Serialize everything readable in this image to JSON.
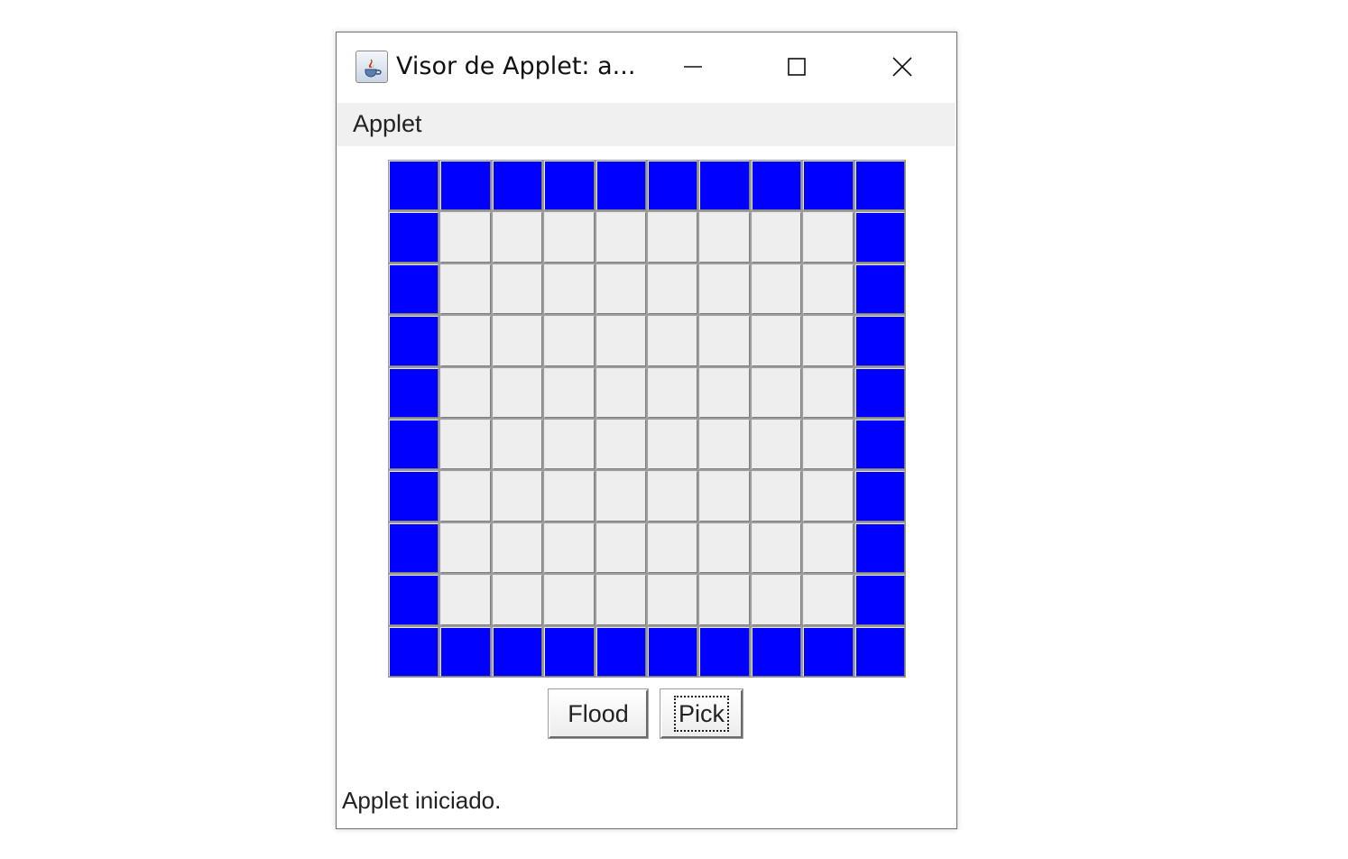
{
  "window": {
    "title": "Visor de Applet: a...",
    "icon": "java-cup-icon",
    "controls": {
      "minimize": "minimize-icon",
      "maximize": "maximize-icon",
      "close": "close-icon"
    }
  },
  "menubar": {
    "items": [
      "Applet"
    ]
  },
  "board": {
    "rows": 10,
    "cols": 10,
    "wall_color": "#0000ff",
    "empty_color": "#eeeeee",
    "cells": [
      "WWWWWWWWWW",
      "W........W",
      "W........W",
      "W........W",
      "W........W",
      "W........W",
      "W........W",
      "W........W",
      "W........W",
      "WWWWWWWWWW"
    ]
  },
  "buttons": {
    "flood": "Flood",
    "pick": "Pick",
    "focused": "pick"
  },
  "status": {
    "text": "Applet iniciado."
  }
}
